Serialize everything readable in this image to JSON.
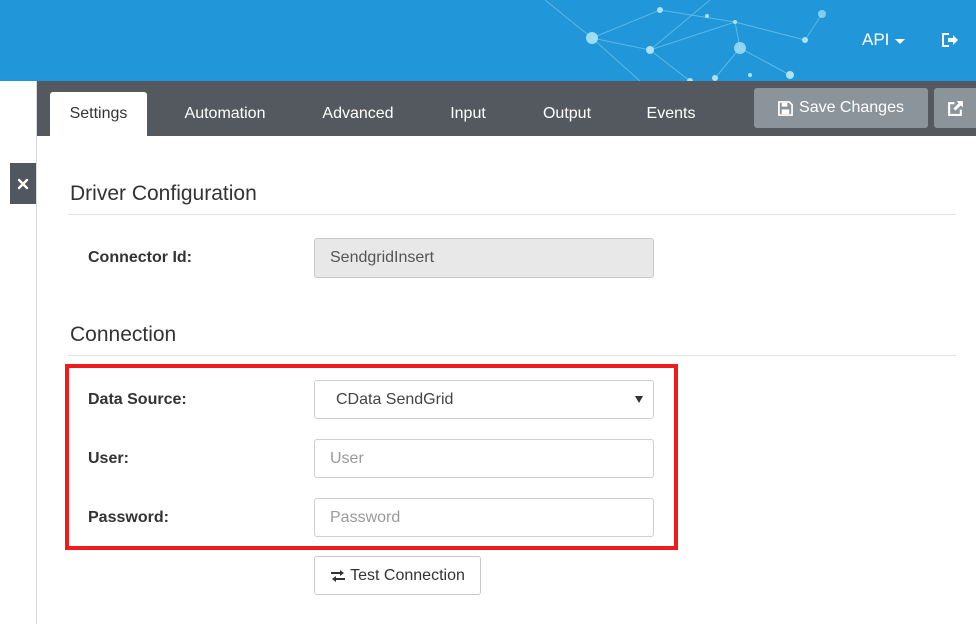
{
  "header": {
    "api_menu_label": "API",
    "bg_color": "#2196d8"
  },
  "sidebar": {
    "close_glyph": "✕"
  },
  "tabs": [
    {
      "label": "Settings",
      "active": true
    },
    {
      "label": "Automation",
      "active": false
    },
    {
      "label": "Advanced",
      "active": false
    },
    {
      "label": "Input",
      "active": false
    },
    {
      "label": "Output",
      "active": false
    },
    {
      "label": "Events",
      "active": false
    }
  ],
  "toolbar": {
    "save_label": "Save Changes",
    "save_icon": "floppy-disk-icon",
    "external_icon": "external-link-icon"
  },
  "driver_config": {
    "title": "Driver Configuration",
    "connector_id_label": "Connector Id:",
    "connector_id_value": "SendgridInsert"
  },
  "connection": {
    "title": "Connection",
    "data_source_label": "Data Source:",
    "data_source_value": "CData SendGrid",
    "user_label": "User:",
    "user_placeholder": "User",
    "password_label": "Password:",
    "password_placeholder": "Password",
    "test_button_label": "Test Connection",
    "test_button_icon": "exchange-arrows-icon"
  },
  "highlight_color": "#ee1c1c"
}
